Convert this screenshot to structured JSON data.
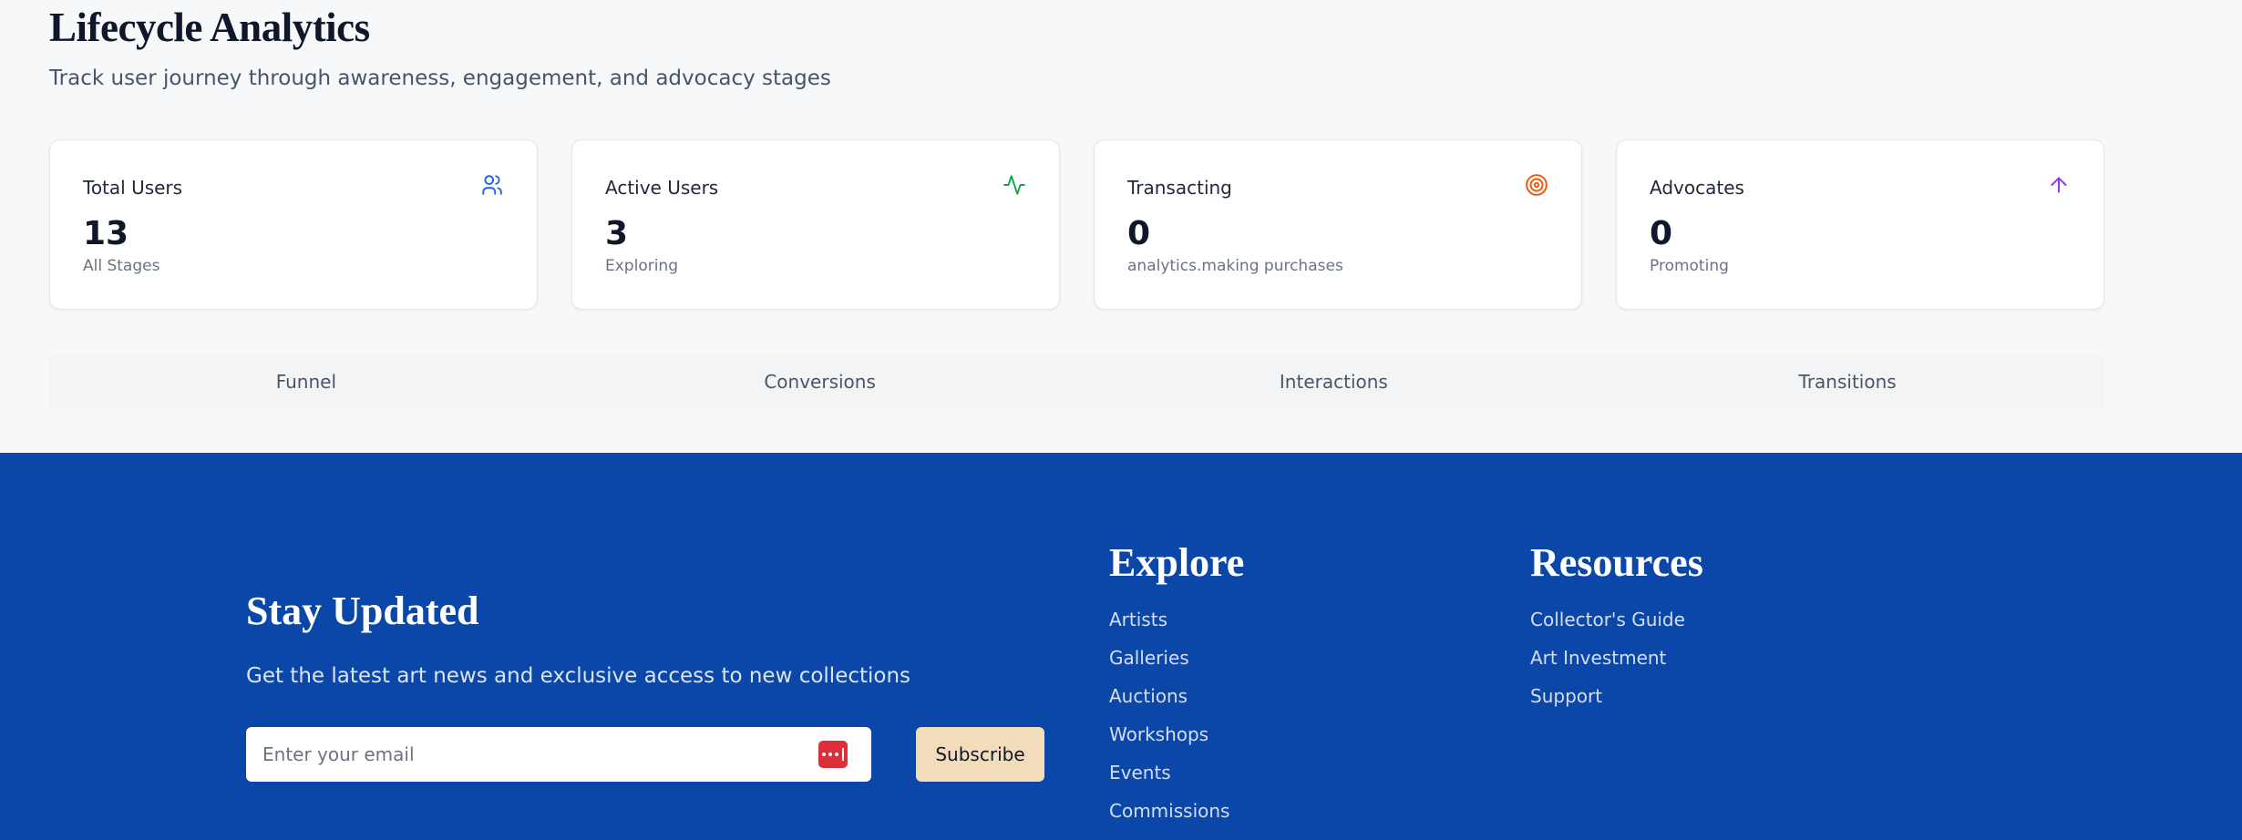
{
  "header": {
    "title": "Lifecycle Analytics",
    "subtitle": "Track user journey through awareness, engagement, and advocacy stages"
  },
  "cards": [
    {
      "title": "Total Users",
      "value": "13",
      "note": "All Stages",
      "icon": "users-icon",
      "color": "#2563eb"
    },
    {
      "title": "Active Users",
      "value": "3",
      "note": "Exploring",
      "icon": "activity-icon",
      "color": "#16a34a"
    },
    {
      "title": "Transacting",
      "value": "0",
      "note": "analytics.making purchases",
      "icon": "target-icon",
      "color": "#ea580c"
    },
    {
      "title": "Advocates",
      "value": "0",
      "note": "Promoting",
      "icon": "arrow-up-icon",
      "color": "#9333ea"
    }
  ],
  "tabs": [
    "Funnel",
    "Conversions",
    "Interactions",
    "Transitions"
  ],
  "footer": {
    "background": "#0a47a9",
    "stay_title": "Stay Updated",
    "stay_sub": "Get the latest art news and exclusive access to new collections",
    "email_placeholder": "Enter your email",
    "subscribe_label": "Subscribe",
    "explore": {
      "title": "Explore",
      "links": [
        "Artists",
        "Galleries",
        "Auctions",
        "Workshops",
        "Events",
        "Commissions"
      ]
    },
    "resources": {
      "title": "Resources",
      "links": [
        "Collector's Guide",
        "Art Investment",
        "Support"
      ]
    }
  }
}
